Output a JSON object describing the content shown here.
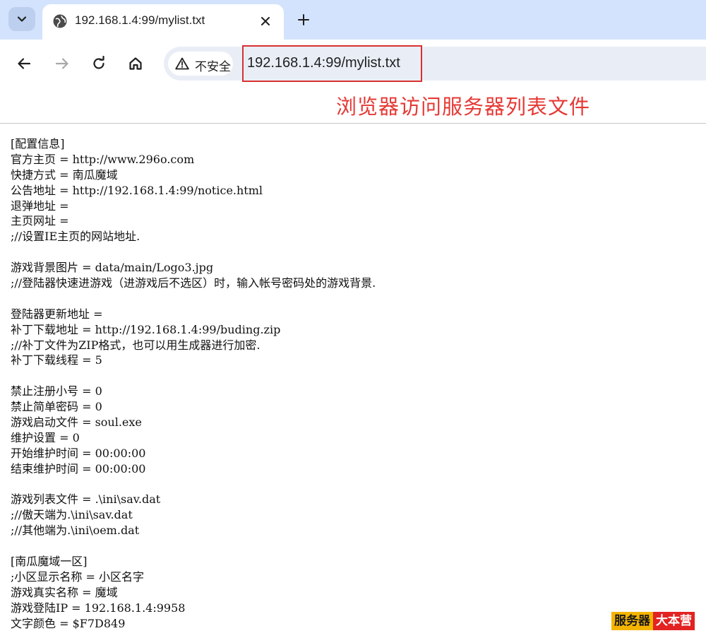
{
  "browser": {
    "tab": {
      "title": "192.168.1.4:99/mylist.txt",
      "icon": "globe-icon"
    },
    "address_bar": {
      "security_label": "不安全",
      "url": "192.168.1.4:99/mylist.txt"
    },
    "colors": {
      "tabstrip": "#d3e3fd",
      "omnibox": "#e9eef6",
      "highlight_border": "#d93030"
    }
  },
  "annotation": {
    "text": "浏览器访问服务器列表文件",
    "color": "#e53935"
  },
  "file_lines": [
    "[配置信息]",
    "官方主页 = http://www.296o.com",
    "快捷方式 = 南瓜魔域",
    "公告地址 = http://192.168.1.4:99/notice.html",
    "退弹地址 =",
    "主页网址 =",
    ";//设置IE主页的网站地址.",
    "",
    "游戏背景图片 = data/main/Logo3.jpg",
    ";//登陆器快速进游戏（进游戏后不选区）时，输入帐号密码处的游戏背景.",
    "",
    "登陆器更新地址 =",
    "补丁下载地址 = http://192.168.1.4:99/buding.zip",
    ";//补丁文件为ZIP格式，也可以用生成器进行加密.",
    "补丁下载线程 = 5",
    "",
    "禁止注册小号 = 0",
    "禁止简单密码 = 0",
    "游戏启动文件 = soul.exe",
    "维护设置 = 0",
    "开始维护时间 = 00:00:00",
    "结束维护时间 = 00:00:00",
    "",
    "游戏列表文件 = .\\ini\\sav.dat",
    ";//傲天端为.\\ini\\sav.dat",
    ";//其他端为.\\ini\\oem.dat",
    "",
    "[南瓜魔域一区]",
    ";小区显示名称 = 小区名字",
    "游戏真实名称 = 魔域",
    "游戏登陆IP = 192.168.1.4:9958",
    "文字颜色 = $F7D849"
  ],
  "watermark": {
    "part1": "服务器",
    "part2": "大本营"
  }
}
